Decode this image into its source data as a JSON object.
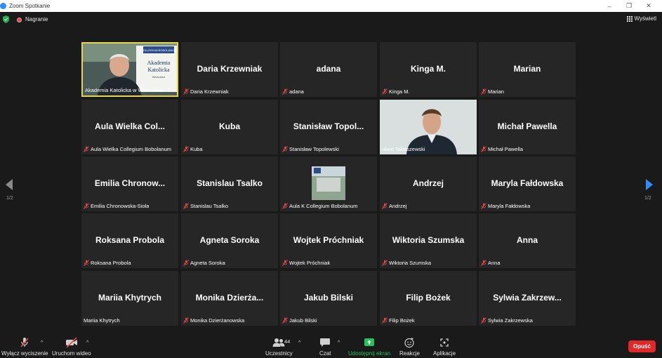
{
  "window": {
    "title": "Zoom Spotkanie"
  },
  "topbar": {
    "recording_label": "Nagranie",
    "view_label": "Wyświetl"
  },
  "tiles": [
    {
      "big": "",
      "caption": "Akademia Katolicka w Warszawie - Co...",
      "muted": false,
      "video": "speaker"
    },
    {
      "big": "Daria Krzewniak",
      "caption": "Daria Krzewniak",
      "muted": true
    },
    {
      "big": "adana",
      "caption": "adana",
      "muted": true
    },
    {
      "big": "Kinga M.",
      "caption": "Kinga M.",
      "muted": true
    },
    {
      "big": "Marian",
      "caption": "Marian",
      "muted": true
    },
    {
      "big": "Aula Wielka Col...",
      "caption": "Aula Wielka Collegium Bobolanum",
      "muted": true
    },
    {
      "big": "Kuba",
      "caption": "Kuba",
      "muted": true
    },
    {
      "big": "Stanisław Topol...",
      "caption": "Stanisław Topolewski",
      "muted": true
    },
    {
      "big": "",
      "caption": "obert Tabaszewski",
      "muted": false,
      "video": "person"
    },
    {
      "big": "Michał Pawella",
      "caption": "Michał Pawella",
      "muted": true
    },
    {
      "big": "Emilia Chronow...",
      "caption": "Emilia Chronowska-Sioła",
      "muted": true
    },
    {
      "big": "Stanislau Tsalko",
      "caption": "Stanislau Tsalko",
      "muted": true
    },
    {
      "big": "",
      "caption": "Aula K Collegium Bobolanum",
      "muted": true,
      "video": "thumb"
    },
    {
      "big": "Andrzej",
      "caption": "Andrzej",
      "muted": true
    },
    {
      "big": "Maryla Fałdowska",
      "caption": "Maryla Fałdowska",
      "muted": true
    },
    {
      "big": "Roksana Probola",
      "caption": "Roksana Probola",
      "muted": true
    },
    {
      "big": "Agneta Soroka",
      "caption": "Agneta Soroka",
      "muted": true
    },
    {
      "big": "Wojtek Próchniak",
      "caption": "Wojtek Próchniak",
      "muted": true
    },
    {
      "big": "Wiktoria Szumska",
      "caption": "Wiktoria Szumska",
      "muted": true
    },
    {
      "big": "Anna",
      "caption": "Anna",
      "muted": true
    },
    {
      "big": "Mariia Khytrych",
      "caption": "Mariia Khytrych",
      "muted": false
    },
    {
      "big": "Monika Dzierża...",
      "caption": "Monika Dzierżanowska",
      "muted": true
    },
    {
      "big": "Jakub Bilski",
      "caption": "Jakub Bilski",
      "muted": true
    },
    {
      "big": "Filip Bożek",
      "caption": "Filip Bożek",
      "muted": true
    },
    {
      "big": "Sylwia Zakrzew...",
      "caption": "Sylwia Zakrzewska",
      "muted": true
    }
  ],
  "speaker_slide": {
    "line1": "Akademia",
    "line2": "Katolicka",
    "line3": "Warszawa",
    "logo": "COLLEGIUM BOBOLANUM"
  },
  "pagination": {
    "left": "1/2",
    "right": "1/2"
  },
  "toolbar": {
    "mute_label": "Wyłącz wyciszenie",
    "video_label": "Uruchom wideo",
    "participants_label": "Uczestnicy",
    "participants_count": "44",
    "chat_label": "Czat",
    "share_label": "Udostępnij ekran",
    "reactions_label": "Reakcje",
    "apps_label": "Aplikacje",
    "leave_label": "Opuść"
  },
  "colors": {
    "active_border": "#e6d44b",
    "share_green": "#25c25a",
    "leave_red": "#e02828",
    "muted_red": "#e0484a"
  }
}
